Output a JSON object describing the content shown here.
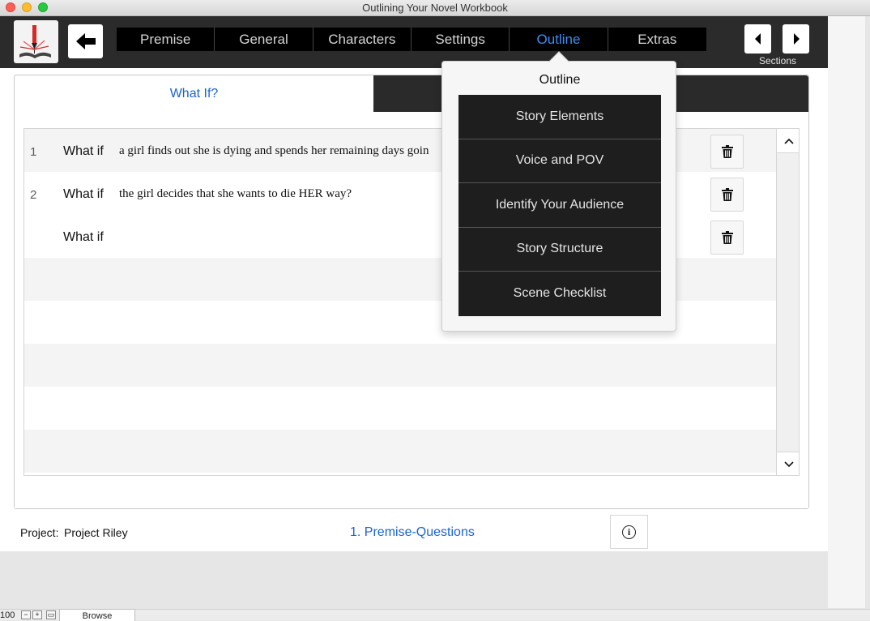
{
  "window": {
    "title": "Outlining Your Novel Workbook"
  },
  "nav": {
    "items": [
      {
        "label": "Premise"
      },
      {
        "label": "General"
      },
      {
        "label": "Characters"
      },
      {
        "label": "Settings"
      },
      {
        "label": "Outline",
        "active": true
      },
      {
        "label": "Extras"
      }
    ]
  },
  "sections": {
    "label": "Sections"
  },
  "tabs": {
    "what_if": "What If?"
  },
  "what_if": {
    "rows": [
      {
        "num": "1",
        "label": "What if",
        "text": "a girl finds out she is dying and spends her remaining days goin"
      },
      {
        "num": "2",
        "label": "What if",
        "text": "the girl decides that she wants to die HER way?"
      },
      {
        "num": "",
        "label": "What if",
        "text": ""
      }
    ]
  },
  "footer": {
    "project_label": "Project:",
    "project_value": "Project Riley",
    "breadcrumb": "1. Premise-Questions"
  },
  "popover": {
    "title": "Outline",
    "items": [
      {
        "label": "Story Elements"
      },
      {
        "label": "Voice and POV"
      },
      {
        "label": "Identify Your Audience"
      },
      {
        "label": "Story Structure"
      },
      {
        "label": "Scene Checklist"
      }
    ]
  },
  "statusbar": {
    "zoom": "100",
    "mode": "Browse"
  },
  "colors": {
    "accent": "#1a63d6",
    "nav_active": "#3b8ef5",
    "header_bg": "#2b2b2b"
  }
}
